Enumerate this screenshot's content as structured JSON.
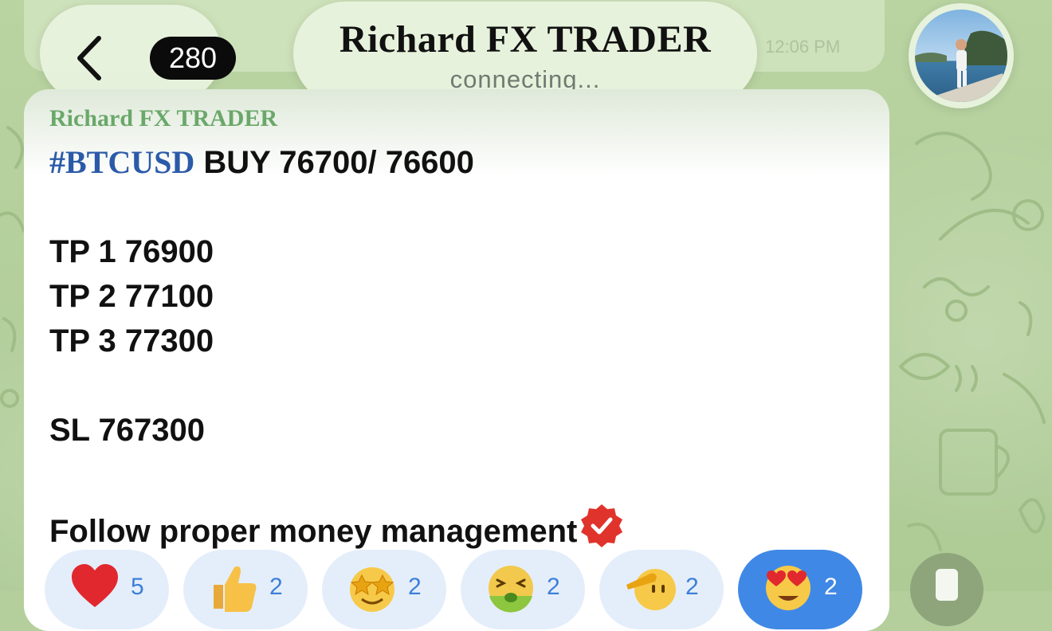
{
  "header": {
    "unread_count": "280",
    "chat_title": "Richard FX TRADER",
    "status": "connecting..."
  },
  "previous_message": {
    "time": "12:06 PM"
  },
  "message": {
    "sender": "Richard FX TRADER",
    "hashtag": "#BTCUSD",
    "signal": "BUY 76700/ 76600",
    "tp1": "TP 1 76900",
    "tp2": "TP 2 77100",
    "tp3": "TP 3 77300",
    "sl": "SL 767300",
    "footer": "Follow proper money management"
  },
  "reactions": [
    {
      "icon": "red-heart-icon",
      "count": "5",
      "selected": false
    },
    {
      "icon": "thumbs-up-icon",
      "count": "2",
      "selected": false
    },
    {
      "icon": "star-struck-icon",
      "count": "2",
      "selected": false
    },
    {
      "icon": "nauseated-face-icon",
      "count": "2",
      "selected": false
    },
    {
      "icon": "saluting-face-icon",
      "count": "2",
      "selected": false
    },
    {
      "icon": "heart-eyes-icon",
      "count": "2",
      "selected": true
    }
  ],
  "colors": {
    "accent": "#3f88e6",
    "sender": "#6aa86a",
    "hashtag": "#2b5aa8",
    "background": "#b4cf9c"
  }
}
